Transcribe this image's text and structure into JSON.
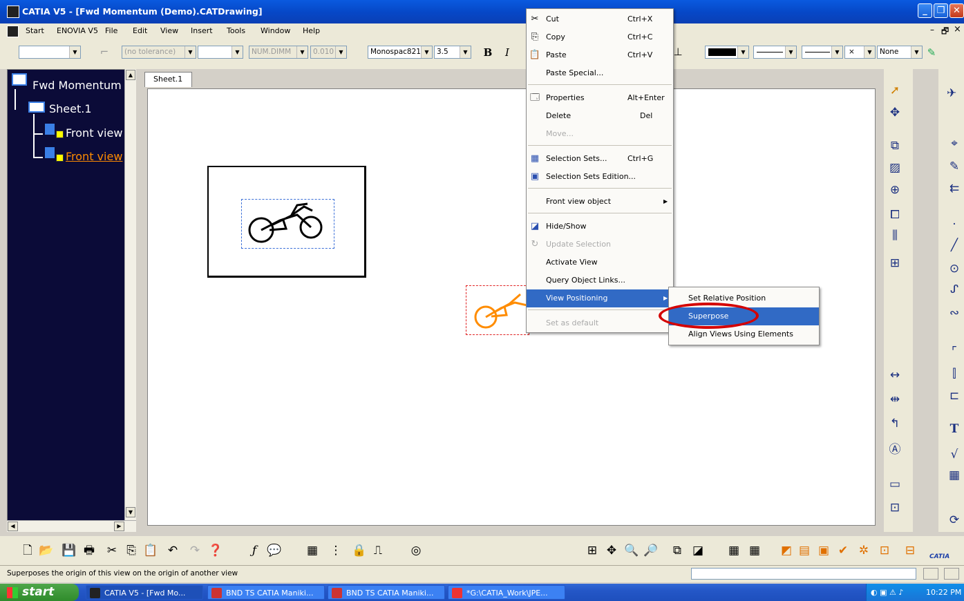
{
  "window": {
    "title": "CATIA V5 - [Fwd Momentum (Demo).CATDrawing]",
    "controls": [
      "_",
      "❐",
      "✕"
    ],
    "inner_controls": [
      "–",
      "🗗",
      "×"
    ]
  },
  "menubar": {
    "items": [
      "Start",
      "ENOVIA V5",
      "File",
      "Edit",
      "View",
      "Insert",
      "Tools",
      "Window",
      "Help"
    ]
  },
  "text_toolbar": {
    "tolerance": "(no tolerance)",
    "num_format": "NUM.DIMM",
    "precision": "0.010",
    "font_name": "Monospac821",
    "font_size": "3.5",
    "bold": "B",
    "italic": "I",
    "line_style": "None"
  },
  "tree": {
    "root": "Fwd Momentum",
    "sheet": "Sheet.1",
    "view1": "Front view",
    "view2": "Front view"
  },
  "sheet_tab": "Sheet.1",
  "context_menu": {
    "items": [
      {
        "label": "Cut",
        "shortcut": "Ctrl+X",
        "icon": "scissors-icon",
        "glyph": "✂",
        "state": "normal"
      },
      {
        "label": "Copy",
        "shortcut": "Ctrl+C",
        "icon": "copy-icon",
        "glyph": "⎘",
        "state": "normal"
      },
      {
        "label": "Paste",
        "shortcut": "Ctrl+V",
        "icon": "paste-icon",
        "glyph": "📋",
        "state": "normal"
      },
      {
        "label": "Paste Special...",
        "shortcut": "",
        "icon": "",
        "glyph": "",
        "state": "normal"
      },
      {
        "label": "Properties",
        "shortcut": "Alt+Enter",
        "icon": "properties-icon",
        "glyph": "🗔",
        "state": "normal"
      },
      {
        "label": "Delete",
        "shortcut": "Del",
        "icon": "",
        "glyph": "",
        "state": "normal"
      },
      {
        "label": "Move...",
        "shortcut": "",
        "icon": "",
        "glyph": "",
        "state": "disabled"
      },
      {
        "label": "Selection Sets...",
        "shortcut": "Ctrl+G",
        "icon": "selection-sets-icon",
        "glyph": "▦",
        "state": "normal"
      },
      {
        "label": "Selection Sets Edition...",
        "shortcut": "",
        "icon": "selection-sets-edition-icon",
        "glyph": "▣",
        "state": "normal"
      },
      {
        "label": "Front view object",
        "shortcut": "",
        "icon": "",
        "glyph": "",
        "state": "submenu"
      },
      {
        "label": "Hide/Show",
        "shortcut": "",
        "icon": "hide-show-icon",
        "glyph": "◪",
        "state": "normal"
      },
      {
        "label": "Update Selection",
        "shortcut": "",
        "icon": "update-icon",
        "glyph": "↻",
        "state": "disabled"
      },
      {
        "label": "Activate View",
        "shortcut": "",
        "icon": "",
        "glyph": "",
        "state": "normal"
      },
      {
        "label": "Query Object Links...",
        "shortcut": "",
        "icon": "",
        "glyph": "",
        "state": "normal"
      },
      {
        "label": "View Positioning",
        "shortcut": "",
        "icon": "",
        "glyph": "",
        "state": "highlighted"
      },
      {
        "label": "Set as default",
        "shortcut": "",
        "icon": "",
        "glyph": "",
        "state": "disabled"
      }
    ]
  },
  "submenu": {
    "items": [
      {
        "label": "Set Relative Position",
        "state": "normal"
      },
      {
        "label": "Superpose",
        "state": "highlighted"
      },
      {
        "label": "Align Views Using Elements",
        "state": "normal"
      }
    ]
  },
  "colors": {
    "highlight": "#316ac5",
    "tree_bg": "#0b0b38",
    "selected_view": "#ff8c00",
    "annotation_circle": "#d40000"
  },
  "status": {
    "message": "Superposes the origin of this view on the origin of another view"
  },
  "taskbar": {
    "start": "start",
    "tasks": [
      "CATIA V5 - [Fwd Mo...",
      "BND TS CATIA Maniki...",
      "BND TS CATIA Maniki...",
      "*G:\\CATIA_Work\\JPE..."
    ],
    "clock": "10:22 PM"
  },
  "brand": "CATIA"
}
